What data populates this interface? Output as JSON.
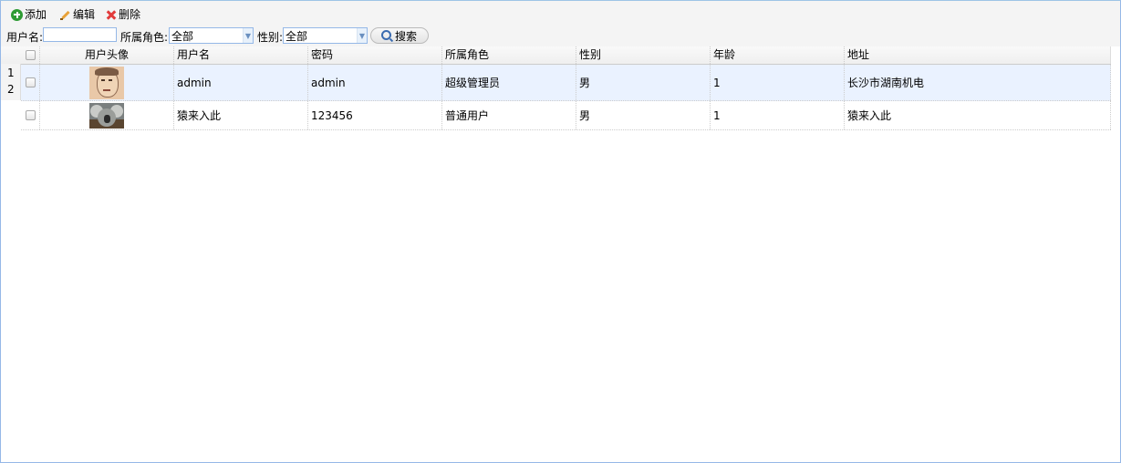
{
  "toolbar": {
    "add_label": "添加",
    "edit_label": "编辑",
    "delete_label": "删除"
  },
  "search": {
    "username_label": "用户名:",
    "username_value": "",
    "role_label": "所属角色:",
    "role_value": "全部",
    "gender_label": "性别:",
    "gender_value": "全部",
    "search_button": "搜索"
  },
  "grid": {
    "columns": [
      "用户头像",
      "用户名",
      "密码",
      "所属角色",
      "性别",
      "年龄",
      "地址"
    ],
    "rows": [
      {
        "rownum": "1",
        "avatar": "avatar-man-sketch",
        "username": "admin",
        "password": "admin",
        "role": "超级管理员",
        "gender": "男",
        "age": "1",
        "address": "长沙市湖南机电"
      },
      {
        "rownum": "2",
        "avatar": "avatar-koala",
        "username": "猿来入此",
        "password": "123456",
        "role": "普通用户",
        "gender": "男",
        "age": "1",
        "address": "猿来入此"
      }
    ]
  },
  "colors": {
    "selected_row": "#eaf2ff",
    "border": "#95b8e7",
    "add_icon": "#2e9b33",
    "delete_icon": "#e23b3b"
  }
}
